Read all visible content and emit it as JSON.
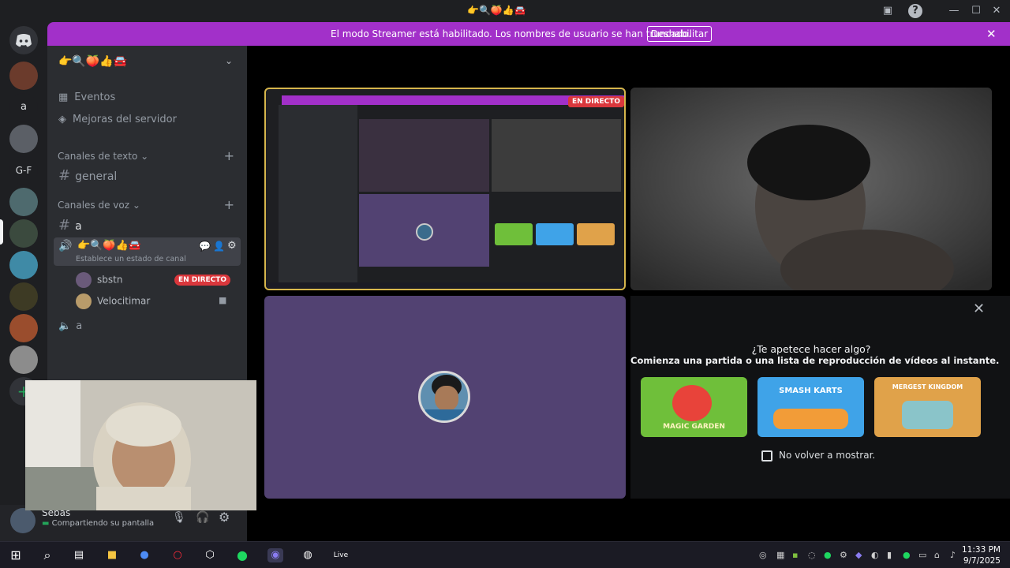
{
  "window": {
    "title": "👉🔍🍑👍🚘"
  },
  "banner": {
    "message": "El modo Streamer está habilitado. Los nombres de usuario se han truncado.",
    "button_label": "Deshabilitar"
  },
  "rail": {
    "servers": [
      "a",
      "G-F"
    ]
  },
  "sidebar": {
    "server_name": "👉🔍🍑👍🚘",
    "events_label": "Eventos",
    "boosts_label": "Mejoras del servidor",
    "text_category": "Canales de texto",
    "voice_category": "Canales de voz",
    "text_channels": [
      "general"
    ],
    "voice_channels": [
      {
        "name": "a"
      },
      {
        "name": "👉🔍🍑👍🚘",
        "status": "Establece un estado de canal"
      },
      {
        "name": "a"
      }
    ],
    "members": [
      {
        "name": "sbstn",
        "badge": "EN DIRECTO"
      },
      {
        "name": "Velocitimar"
      }
    ]
  },
  "user_panel": {
    "username": "Sebas",
    "status": "Compartiendo su pantalla"
  },
  "stream": {
    "live_badge": "EN DIRECTO"
  },
  "activity": {
    "question": "¿Te apetece hacer algo?",
    "subtitle": "Comienza una partida o una lista de reproducción de vídeos al instante.",
    "games": [
      {
        "name": "MAGIC GARDEN",
        "color": "#6fbf3a"
      },
      {
        "name": "SMASH KARTS",
        "color": "#3fa3e8"
      },
      {
        "name": "MERGEST KINGDOM",
        "color": "#e0a24a"
      }
    ],
    "dont_show_label": "No volver a mostrar."
  },
  "taskbar": {
    "live_label": "Live",
    "time": "11:33 PM",
    "date": "9/7/2025"
  },
  "colors": {
    "banner": "#a230c9",
    "live": "#da373c",
    "avatar_tile": "#524272",
    "sidebar": "#2b2d31"
  }
}
